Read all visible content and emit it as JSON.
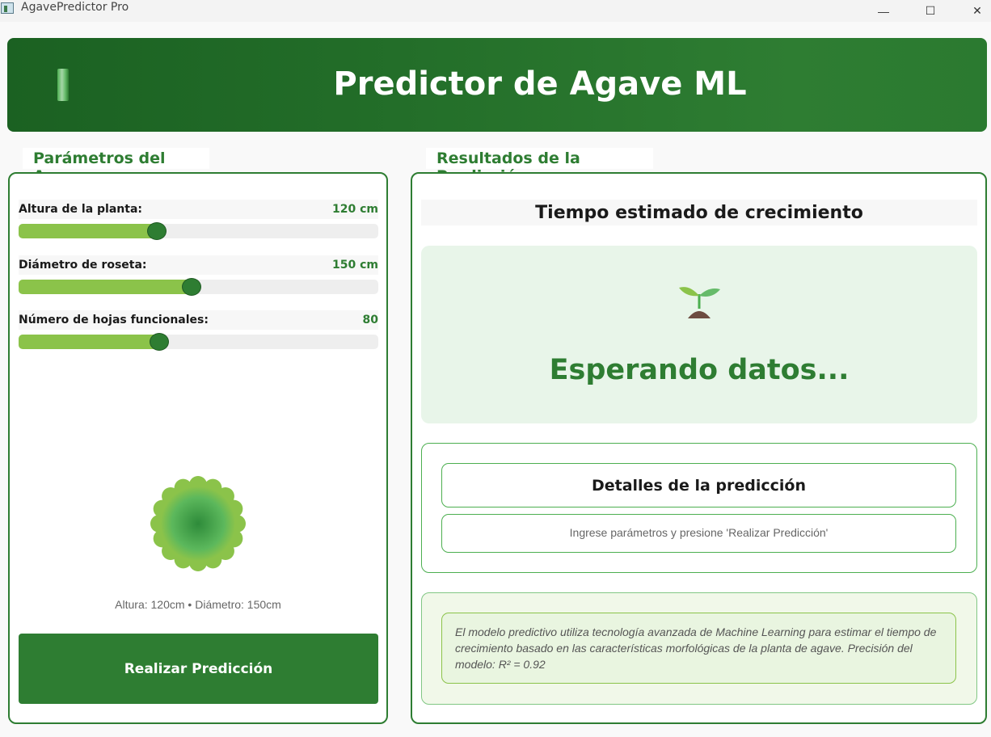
{
  "window": {
    "title": "AgavePredictor Pro",
    "minimize_glyph": "—",
    "maximize_glyph": "☐",
    "close_glyph": "✕"
  },
  "header": {
    "title": "Predictor de Agave ML",
    "logo_icon": "agave-leaf-icon"
  },
  "parameters": {
    "section_title": "Parámetros del Agave",
    "sliders": [
      {
        "label": "Altura de la planta:",
        "value_text": "120 cm",
        "fraction": 0.385
      },
      {
        "label": "Diámetro de roseta:",
        "value_text": "150 cm",
        "fraction": 0.48
      },
      {
        "label": "Número de hojas funcionales:",
        "value_text": "80",
        "fraction": 0.392
      }
    ],
    "preview_caption": "Altura: 120cm • Diámetro: 150cm",
    "predict_button": "Realizar Predicción"
  },
  "results": {
    "section_title": "Resultados de la Predicción",
    "heading": "Tiempo estimado de crecimiento",
    "status_icon": "seedling-icon",
    "status_text": "Esperando datos...",
    "details_title": "Detalles de la predicción",
    "details_text": "Ingrese parámetros y presione 'Realizar Predicción'",
    "info_text": "El modelo predictivo utiliza tecnología avanzada de Machine Learning para estimar el tiempo de crecimiento basado en las características morfológicas de la planta de agave. Precisión del modelo: R² = 0.92"
  },
  "colors": {
    "primary": "#2e7d32",
    "accent": "#8bc34a",
    "result_bg": "#e8f5e9"
  }
}
